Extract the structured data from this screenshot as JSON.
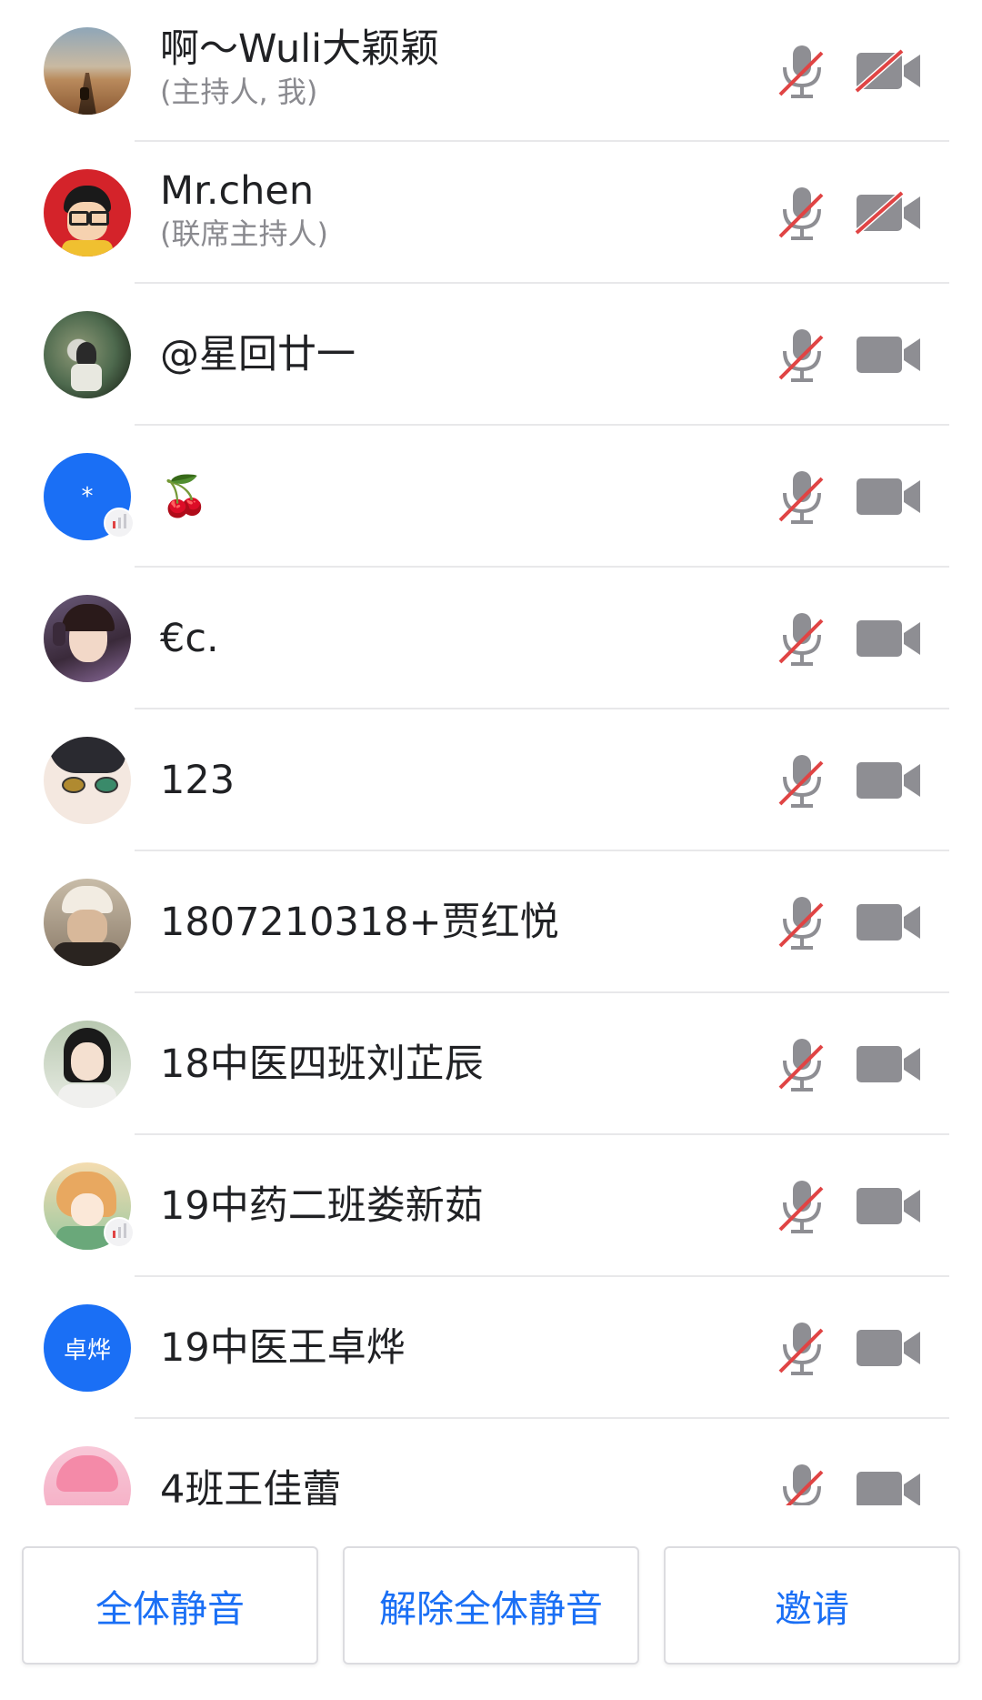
{
  "participants": [
    {
      "name": "啊～Wuli大颖颖",
      "role": "(主持人, 我)",
      "mic": "muted",
      "camera": "off",
      "avatar": "photo-desert-road"
    },
    {
      "name": "Mr.chen",
      "role": "(联席主持人)",
      "mic": "muted",
      "camera": "off",
      "avatar": "photo-cartoon-boy"
    },
    {
      "name": "@星回廿一",
      "role": "",
      "mic": "muted",
      "camera": "on",
      "avatar": "photo-game-scene"
    },
    {
      "name": "🍒",
      "role": "",
      "mic": "muted",
      "camera": "on",
      "avatar": "default-blue",
      "avatar_text": "*"
    },
    {
      "name": "€c.",
      "role": "",
      "mic": "muted",
      "camera": "on",
      "avatar": "photo-girl-headphones"
    },
    {
      "name": "123",
      "role": "",
      "mic": "muted",
      "camera": "on",
      "avatar": "photo-anime-face"
    },
    {
      "name": "1807210318+贾红悦",
      "role": "",
      "mic": "muted",
      "camera": "on",
      "avatar": "photo-girl-cap"
    },
    {
      "name": "18中医四班刘芷辰",
      "role": "",
      "mic": "muted",
      "camera": "on",
      "avatar": "photo-girl-portrait"
    },
    {
      "name": "19中药二班娄新茹",
      "role": "",
      "mic": "muted",
      "camera": "on",
      "avatar": "photo-anime-girl"
    },
    {
      "name": "19中医王卓烨",
      "role": "",
      "mic": "muted",
      "camera": "on",
      "avatar": "default-blue",
      "avatar_text": "卓烨"
    },
    {
      "name": "4班王佳蕾",
      "role": "",
      "mic": "muted",
      "camera": "on",
      "avatar": "photo-pink-anime"
    }
  ],
  "footer": {
    "mute_all": "全体静音",
    "unmute_all": "解除全体静音",
    "invite": "邀请"
  },
  "colors": {
    "accent": "#1a6ff5",
    "muted_slash": "#e04444",
    "icon_gray": "#8e8e93"
  }
}
